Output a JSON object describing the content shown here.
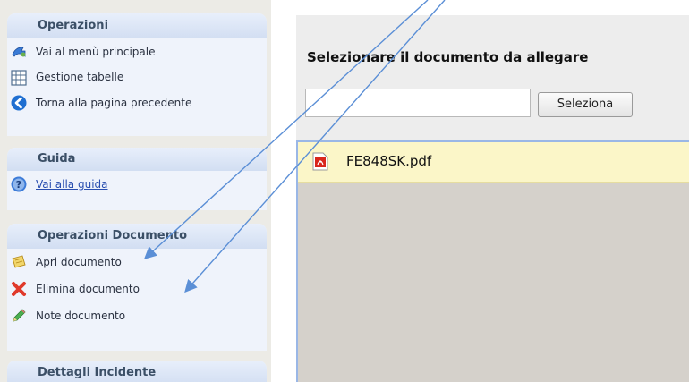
{
  "sidebar": {
    "operazioni": {
      "title": "Operazioni",
      "items": [
        {
          "label": "Vai al menù principale",
          "icon": "home-icon"
        },
        {
          "label": "Gestione tabelle",
          "icon": "table-icon"
        },
        {
          "label": "Torna alla pagina precedente",
          "icon": "back-arrow-icon"
        }
      ]
    },
    "guida": {
      "title": "Guida",
      "items": [
        {
          "label": "Vai alla guida",
          "icon": "help-icon"
        }
      ]
    },
    "operazioni_documento": {
      "title": "Operazioni Documento",
      "items": [
        {
          "label": "Apri documento",
          "icon": "open-document-icon"
        },
        {
          "label": "Elimina documento",
          "icon": "delete-icon"
        },
        {
          "label": "Note documento",
          "icon": "pencil-icon"
        }
      ]
    },
    "dettagli_incidente": {
      "title": "Dettagli Incidente"
    }
  },
  "main": {
    "title": "Selezionare il documento da allegare",
    "input_value": "",
    "select_button": "Seleziona",
    "files": [
      {
        "name": "FE848SK.pdf",
        "icon": "pdf-icon",
        "selected": true
      }
    ]
  },
  "colors": {
    "panel_header": "#d2def2",
    "selected_row": "#fbf6c8",
    "annotation_arrow": "#5b8fd6"
  }
}
